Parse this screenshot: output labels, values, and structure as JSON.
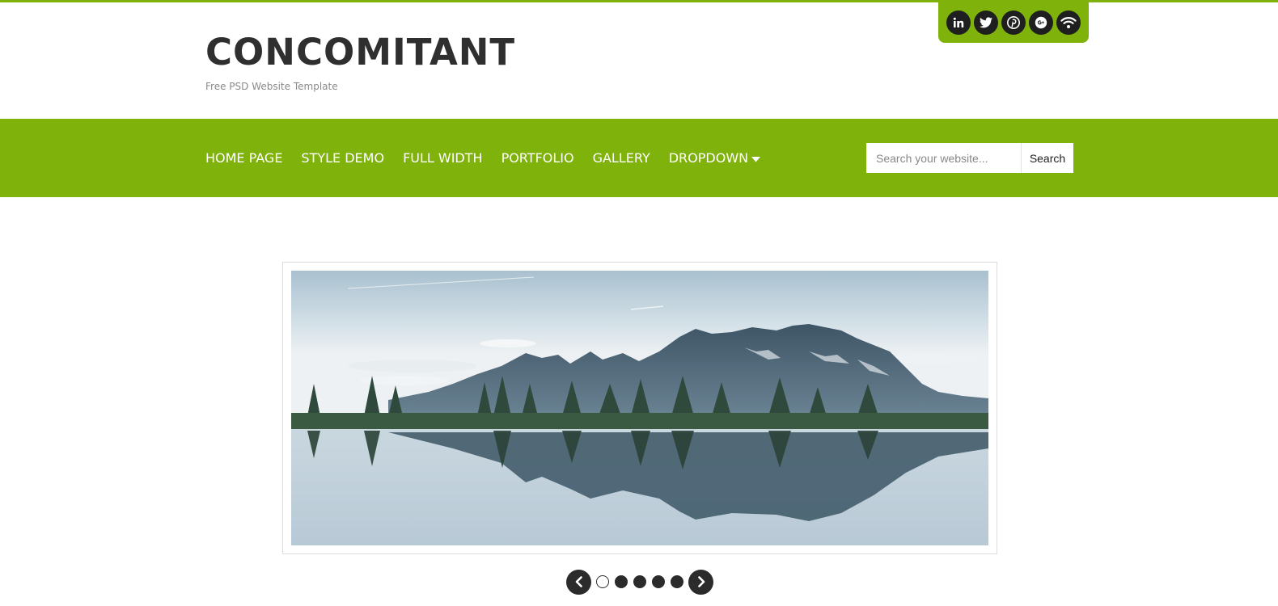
{
  "site": {
    "title": "CONCOMITANT",
    "tagline": "Free PSD Website Template"
  },
  "colors": {
    "accent": "#7fb20b",
    "dark": "#1f1f1f",
    "title": "#2f2f2f"
  },
  "social": [
    {
      "icon": "linkedin-icon"
    },
    {
      "icon": "twitter-icon"
    },
    {
      "icon": "pinterest-icon"
    },
    {
      "icon": "google-plus-icon"
    },
    {
      "icon": "rss-icon"
    }
  ],
  "nav": {
    "items": [
      {
        "label": "HOME PAGE"
      },
      {
        "label": "STYLE DEMO"
      },
      {
        "label": "FULL WIDTH"
      },
      {
        "label": "PORTFOLIO"
      },
      {
        "label": "GALLERY"
      },
      {
        "label": "DROPDOWN",
        "icon": "caret-down-icon"
      }
    ]
  },
  "search": {
    "placeholder": "Search your website...",
    "value": "",
    "button_label": "Search"
  },
  "slider": {
    "slide_count": 5,
    "active_index": 0,
    "prev_icon": "chevron-left-icon",
    "next_icon": "chevron-right-icon"
  }
}
